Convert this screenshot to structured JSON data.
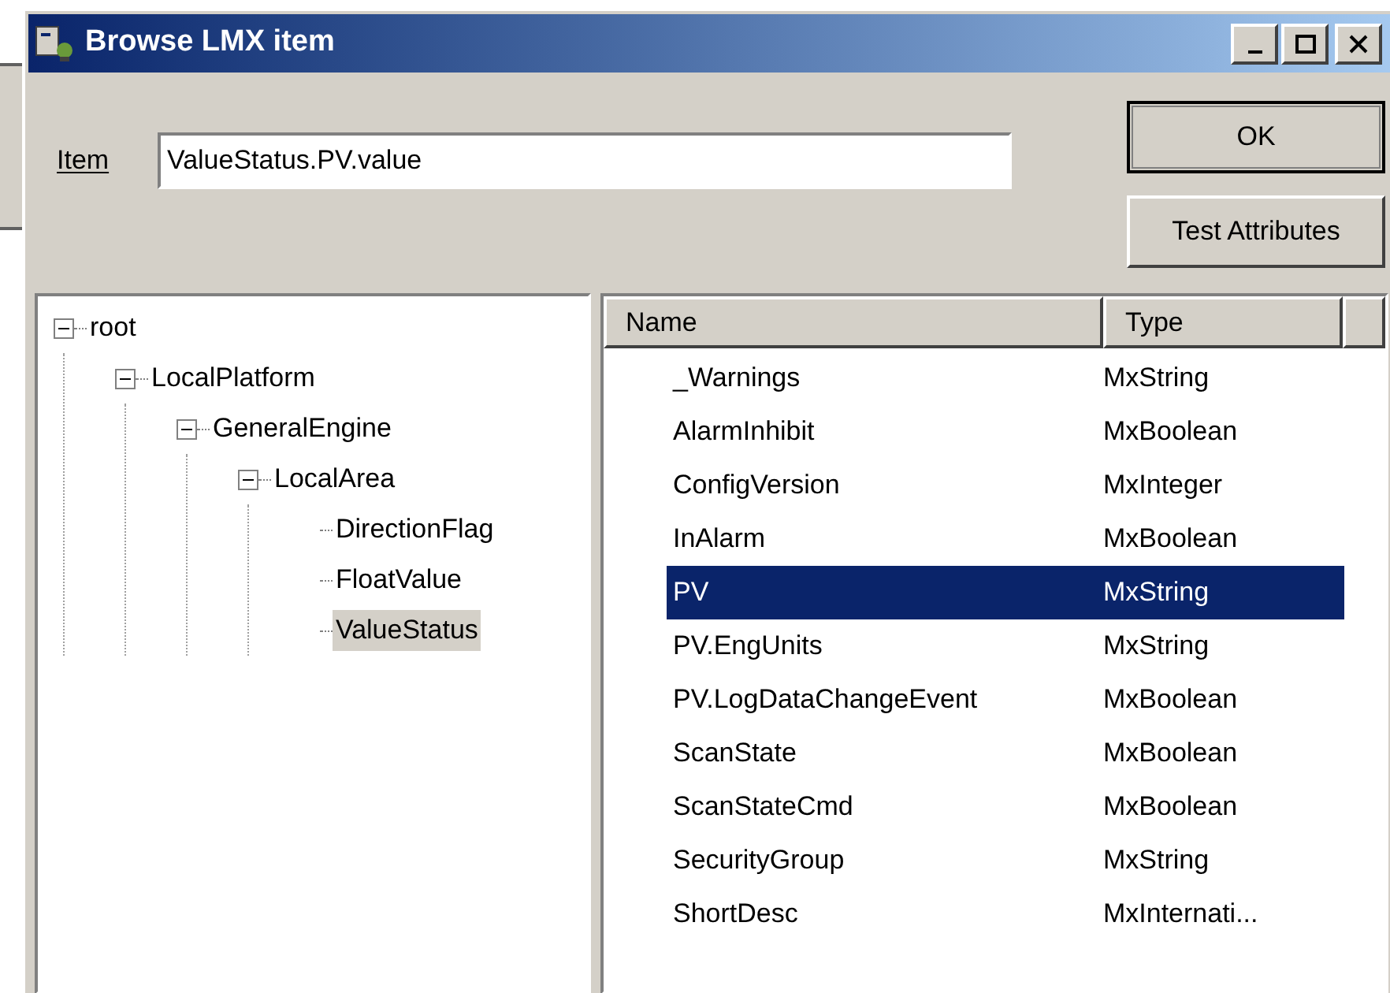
{
  "window": {
    "title": "Browse LMX item"
  },
  "item_field": {
    "label": "Item",
    "value": "ValueStatus.PV.value"
  },
  "buttons": [
    "OK",
    "Test Attributes"
  ],
  "tree": [
    {
      "label": "root",
      "expanded": true,
      "selected": false,
      "children": [
        {
          "label": "LocalPlatform",
          "expanded": true,
          "selected": false,
          "children": [
            {
              "label": "GeneralEngine",
              "expanded": true,
              "selected": false,
              "children": [
                {
                  "label": "LocalArea",
                  "expanded": true,
                  "selected": false,
                  "children": [
                    {
                      "label": "DirectionFlag",
                      "selected": false
                    },
                    {
                      "label": "FloatValue",
                      "selected": false
                    },
                    {
                      "label": "ValueStatus",
                      "selected": true
                    }
                  ]
                }
              ]
            }
          ]
        }
      ]
    }
  ],
  "table": {
    "columns": [
      "Name",
      "Type"
    ],
    "rows": [
      {
        "name": "_Warnings",
        "type": "MxString",
        "selected": false
      },
      {
        "name": "AlarmInhibit",
        "type": "MxBoolean",
        "selected": false
      },
      {
        "name": "ConfigVersion",
        "type": "MxInteger",
        "selected": false
      },
      {
        "name": "InAlarm",
        "type": "MxBoolean",
        "selected": false
      },
      {
        "name": "PV",
        "type": "MxString",
        "selected": true
      },
      {
        "name": "PV.EngUnits",
        "type": "MxString",
        "selected": false
      },
      {
        "name": "PV.LogDataChangeEvent",
        "type": "MxBoolean",
        "selected": false
      },
      {
        "name": "ScanState",
        "type": "MxBoolean",
        "selected": false
      },
      {
        "name": "ScanStateCmd",
        "type": "MxBoolean",
        "selected": false
      },
      {
        "name": "SecurityGroup",
        "type": "MxString",
        "selected": false
      },
      {
        "name": "ShortDesc",
        "type": "MxInternati...",
        "selected": false
      }
    ]
  }
}
